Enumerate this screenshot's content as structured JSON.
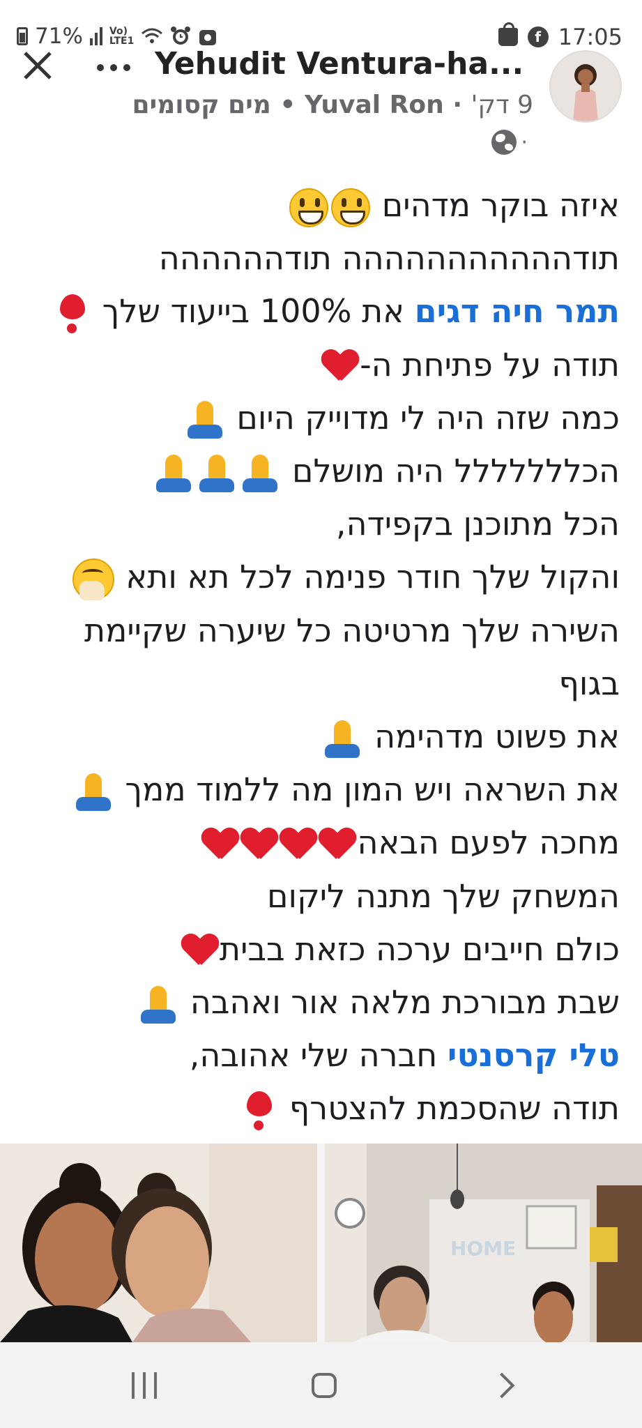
{
  "status_bar": {
    "battery": "71%",
    "network_top": "Vo)",
    "network_bottom": "LTE1",
    "time": "17:05"
  },
  "header": {
    "author": "Yehudit Ventura-ha...",
    "time_ago": "9 דק'",
    "separator1": "·",
    "tagged_user": "Yuval Ron",
    "separator2": "•",
    "location": "מים קסומים",
    "dot": "·"
  },
  "post": {
    "lines": [
      {
        "text": "איזה בוקר מדהים"
      },
      {
        "text": "תודההההההההההה תודהההההה"
      },
      {
        "mention": "תמר חיה דגים",
        "text": " את 100% בייעוד שלך"
      },
      {
        "text": "תודה על פתיחת ה-"
      },
      {
        "text": "כמה שזה היה לי מדוייק היום"
      },
      {
        "text": "הכללללללל היה מושלם"
      },
      {
        "text": "הכל מתוכנן בקפידה,"
      },
      {
        "text": "והקול שלך חודר פנימה לכל תא ותא"
      },
      {
        "text": "השירה שלך מרטיטה כל שיערה שקיימת"
      },
      {
        "text": "בגוף"
      },
      {
        "text": "את פשוט מדהימה"
      },
      {
        "text": "את השראה ויש המון מה ללמוד ממך"
      },
      {
        "text": "מחכה לפעם הבאה"
      },
      {
        "text": "המשחק שלך מתנה ליקום"
      },
      {
        "text": "כולם חייבים ערכה כזאת בבית"
      },
      {
        "text": "שבת מבורכת מלאה אור ואהבה"
      },
      {
        "mention": "טלי קרסנטי",
        "text": " חברה שלי אהובה,"
      },
      {
        "text": "תודה שהסכמת להצטרף"
      }
    ],
    "emojis": {
      "grin": "grinning-face-emoji",
      "heart": "red-heart-emoji",
      "exclaim": "heart-exclamation-emoji",
      "pray": "folded-hands-emoji",
      "hand_over_mouth": "face-with-hand-over-mouth-emoji"
    }
  },
  "photos": {
    "right_wall_text": "HOME"
  },
  "colors": {
    "mention": "#1a6ed8",
    "meta": "#65676b",
    "heart": "#e01e2e"
  }
}
